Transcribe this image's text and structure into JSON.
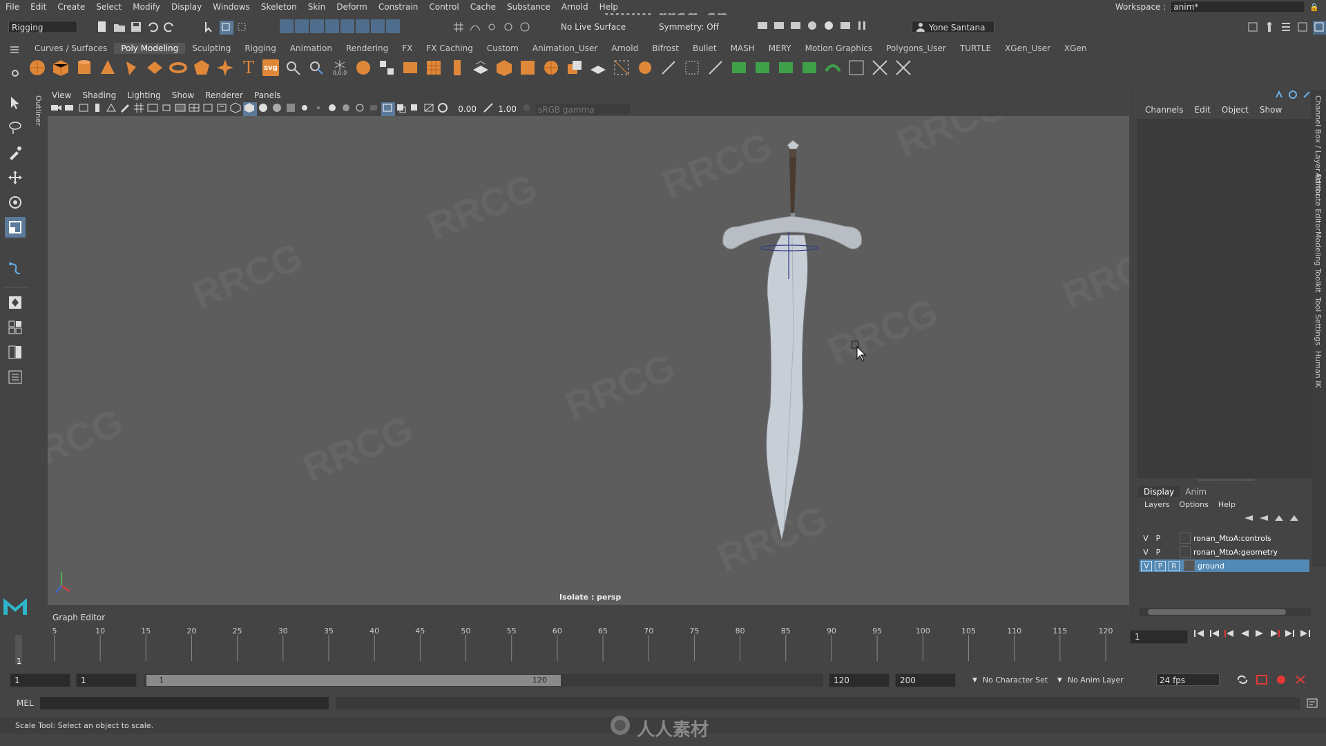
{
  "menubar": {
    "items": [
      "File",
      "Edit",
      "Create",
      "Select",
      "Modify",
      "Display",
      "Windows",
      "Skeleton",
      "Skin",
      "Deform",
      "Constrain",
      "Control",
      "Cache",
      "Substance",
      "Arnold",
      "Help"
    ],
    "watermark": "www.rrcg.cn",
    "workspace_label": "Workspace :",
    "workspace_value": "anim*"
  },
  "statusline": {
    "mode": "Rigging",
    "live_surface": "No Live Surface",
    "symmetry": "Symmetry: Off",
    "user": "Yone Santana"
  },
  "shelf": {
    "tabs": [
      "Curves / Surfaces",
      "Poly Modeling",
      "Sculpting",
      "Rigging",
      "Animation",
      "Rendering",
      "FX",
      "FX Caching",
      "Custom",
      "Animation_User",
      "Arnold",
      "Bifrost",
      "Bullet",
      "MASH",
      "MERY",
      "Motion Graphics",
      "Polygons_User",
      "TURTLE",
      "XGen_User",
      "XGen"
    ],
    "active_tab": "Poly Modeling",
    "text_icon": "T",
    "svg_icon": "svg",
    "coord_icon": "0,0,0"
  },
  "viewport": {
    "menu": [
      "View",
      "Shading",
      "Lighting",
      "Show",
      "Renderer",
      "Panels"
    ],
    "exposure": "0.00",
    "gamma": "1.00",
    "colorspace": "sRGB gamma",
    "isolate_label": "Isolate : persp",
    "outliner_label": "Outliner",
    "object": "sword"
  },
  "channels": {
    "menu": [
      "Channels",
      "Edit",
      "Object",
      "Show"
    ]
  },
  "right_strip": {
    "labels": [
      "Channel Box / Layer Editor",
      "Attribute Editor",
      "Modeling Toolkit",
      "Tool Settings",
      "Human IK"
    ]
  },
  "layers": {
    "tabs": [
      "Display",
      "Anim"
    ],
    "active_tab": "Display",
    "menu": [
      "Layers",
      "Options",
      "Help"
    ],
    "rows": [
      {
        "v": "V",
        "p": "P",
        "r": "",
        "name": "ronan_MtoA:controls",
        "selected": false
      },
      {
        "v": "V",
        "p": "P",
        "r": "",
        "name": "ronan_MtoA:geometry",
        "selected": false
      },
      {
        "v": "V",
        "p": "P",
        "r": "R",
        "name": "ground",
        "selected": true
      }
    ]
  },
  "timeline": {
    "label": "Graph Editor",
    "ticks": [
      "5",
      "10",
      "15",
      "20",
      "25",
      "30",
      "35",
      "40",
      "45",
      "50",
      "55",
      "60",
      "65",
      "70",
      "75",
      "80",
      "85",
      "90",
      "95",
      "100",
      "105",
      "110",
      "115",
      "120"
    ],
    "current_frame_marker": "1",
    "current_frame": "1"
  },
  "range": {
    "start": "1",
    "playback_start": "1",
    "slider_start": "1",
    "slider_end": "120",
    "playback_end": "120",
    "end": "200",
    "character_set": "No Character Set",
    "anim_layer": "No Anim Layer",
    "fps": "24 fps"
  },
  "command": {
    "label": "MEL"
  },
  "help_line": {
    "text": "Scale Tool: Select an object to scale.",
    "watermark": "人人素材"
  },
  "colors": {
    "accent": "#5289b5",
    "viewport_bg": "#5d5d5d",
    "panel_bg": "#444444"
  }
}
